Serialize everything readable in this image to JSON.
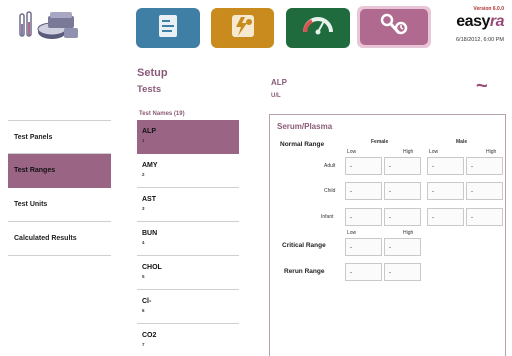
{
  "header": {
    "version": "Version 6.0.0",
    "brand_main": "easy",
    "brand_accent": "ra",
    "datetime": "6/18/2012, 6:00 PM",
    "modules": [
      {
        "icon": "document-list-icon",
        "color": "#3f7fa6"
      },
      {
        "icon": "lightning-person-icon",
        "color": "#c98a1e"
      },
      {
        "icon": "gauge-icon",
        "color": "#1f6b3d"
      },
      {
        "icon": "wrench-tools-icon",
        "color": "#b06a90",
        "selected": true
      }
    ]
  },
  "page": {
    "section": "Setup",
    "subsection": "Tests"
  },
  "nav": {
    "items": [
      {
        "label": "Test Panels"
      },
      {
        "label": "Test Ranges",
        "active": true
      },
      {
        "label": "Test Units"
      },
      {
        "label": "Calculated Results"
      }
    ]
  },
  "tests": {
    "header": "Test Names  (19)",
    "items": [
      {
        "name": "ALP",
        "index": "1",
        "active": true
      },
      {
        "name": "AMY",
        "index": "2"
      },
      {
        "name": "AST",
        "index": "3"
      },
      {
        "name": "BUN",
        "index": "4"
      },
      {
        "name": "CHOL",
        "index": "5"
      },
      {
        "name": "Cl-",
        "index": "6"
      },
      {
        "name": "CO2",
        "index": "7"
      }
    ]
  },
  "detail": {
    "test_name": "ALP",
    "unit": "U/L",
    "panel_title": "Serum/Plasma",
    "normal_range_label": "Normal Range",
    "female_label": "Female",
    "male_label": "Male",
    "low_label": "Low",
    "high_label": "High",
    "rows": {
      "adult": "Adult",
      "child": "Child",
      "infant": "Infant"
    },
    "critical_label": "Critical Range",
    "rerun_label": "Rerun Range",
    "empty_value": "-"
  },
  "colors": {
    "accent": "#9a6585",
    "brand": "#9a4a78"
  }
}
